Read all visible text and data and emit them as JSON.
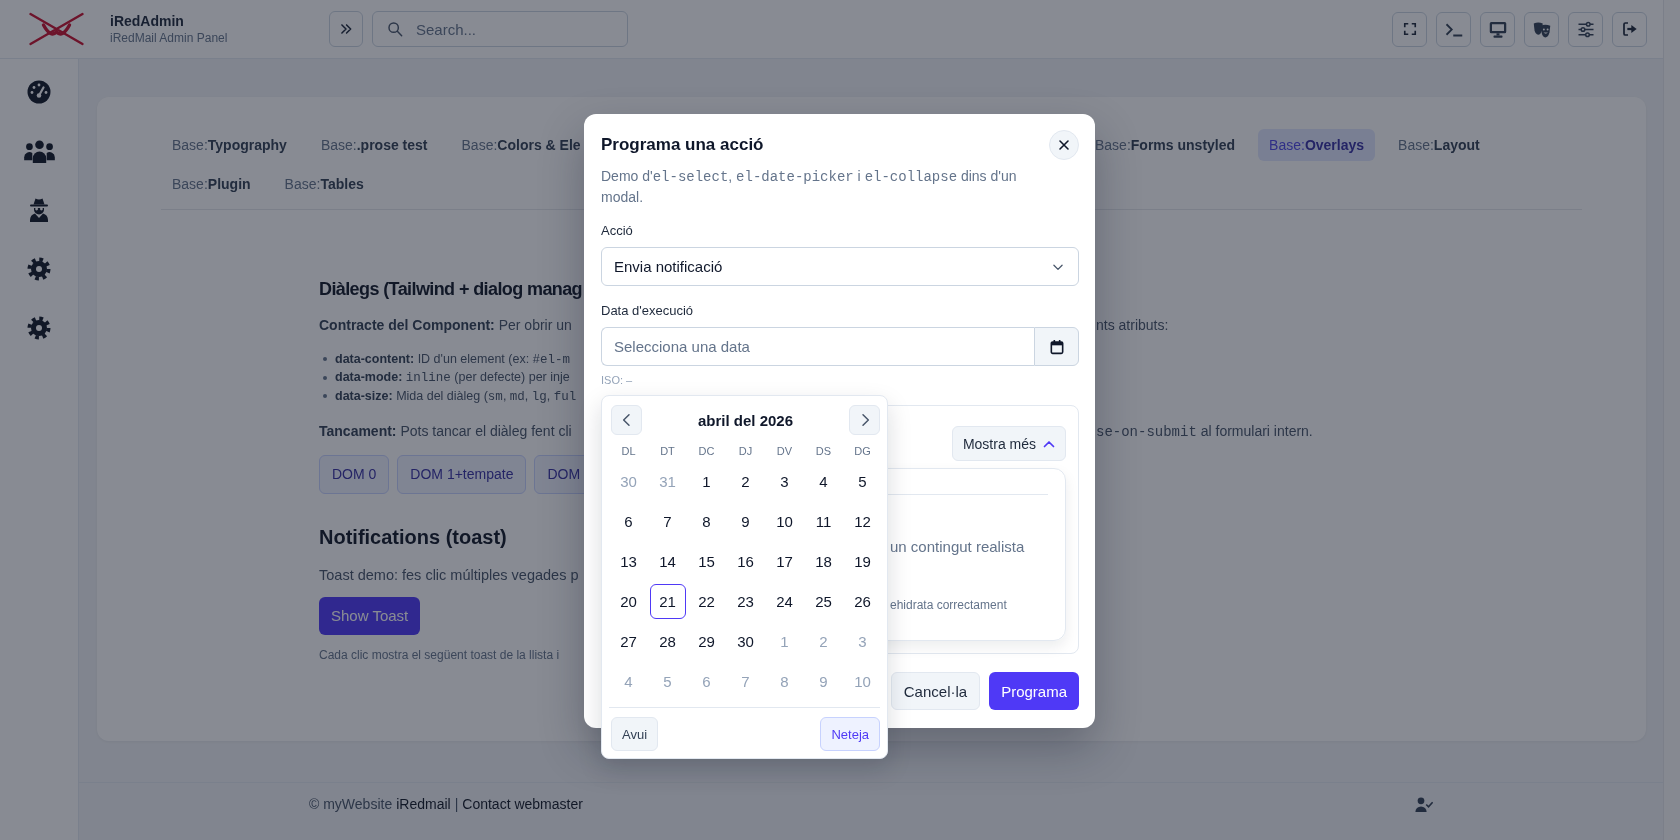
{
  "header": {
    "title": "iRedAdmin",
    "subtitle": "iRedMail Admin Panel",
    "search": {
      "placeholder": "Search..."
    }
  },
  "tab_rows": [
    {
      "items": [
        {
          "label": "Base:**Typography**",
          "selected": false
        },
        {
          "label": "Base:**.prose test**",
          "selected": false
        },
        {
          "label": "Base:**Colors & Ele**",
          "selected": false
        }
      ],
      "items_after_dialog": [
        {
          "label": "Base:**Forms unstyled**",
          "selected": false
        },
        {
          "label": "Base:**Overlays**",
          "selected": true
        },
        {
          "label": "Base:**Layout**",
          "selected": false
        }
      ]
    },
    {
      "items": [
        {
          "label": "Base:**Plugin**",
          "selected": false
        },
        {
          "label": "Base:**Tables**",
          "selected": false
        }
      ]
    }
  ],
  "dialogs_section": {
    "heading": "Diàlegs (Tailwind + dialog manag",
    "contract": {
      "before_dialog": [
        {
          "kind": "text",
          "text": "**Contracte del Component:** Per obrir un"
        }
      ],
      "after_dialog": [
        {
          "kind": "text",
          "text": "nts atributs:"
        }
      ]
    },
    "attributes": [
      [
        {
          "kind": "text",
          "text": "**data-content:** ID d'un element (ex: "
        },
        {
          "kind": "code",
          "text": "#el-m"
        }
      ],
      [
        {
          "kind": "text",
          "text": "**data-mode:** "
        },
        {
          "kind": "code",
          "text": "inline"
        },
        {
          "kind": "text",
          "text": " (per defecte) per inje"
        }
      ],
      [
        {
          "kind": "text",
          "text": "**data-size:** Mida del diàleg ("
        },
        {
          "kind": "code",
          "text": "sm"
        },
        {
          "kind": "text",
          "text": ", "
        },
        {
          "kind": "code",
          "text": "md"
        },
        {
          "kind": "text",
          "text": ", "
        },
        {
          "kind": "code",
          "text": "lg"
        },
        {
          "kind": "text",
          "text": ", "
        },
        {
          "kind": "code",
          "text": "ful"
        }
      ]
    ],
    "closing": {
      "before_dialog": [
        {
          "kind": "text",
          "text": "**Tancament:** Pots tancar el diàleg fent cli"
        }
      ],
      "after_dialog": [
        {
          "kind": "code",
          "text": "se-on-submit"
        },
        {
          "kind": "text",
          "text": " al formulari intern."
        }
      ]
    },
    "buttons": [
      "DOM 0",
      "DOM 1+tempate",
      "DOM"
    ]
  },
  "notifications": {
    "heading": "Notifications (toast)",
    "text": "Toast demo: fes clic múltiples vegades p",
    "button": "Show Toast",
    "note": "Cada clic mostra el següent toast de la llista i"
  },
  "footer": {
    "text": "© myWebsite",
    "link": "iRedmail",
    "separator": "|",
    "contact": "Contact webmaster"
  },
  "dialog": {
    "title": "Programa una acció",
    "description": [
      {
        "kind": "text",
        "text": "Demo d'"
      },
      {
        "kind": "code",
        "text": "el-select"
      },
      {
        "kind": "text",
        "text": ", "
      },
      {
        "kind": "code",
        "text": "el-date-picker"
      },
      {
        "kind": "text",
        "text": " i "
      },
      {
        "kind": "code",
        "text": "el-collapse"
      },
      {
        "kind": "text",
        "text": " dins d'un modal."
      }
    ],
    "action": {
      "label": "Acció",
      "value": "Envia notificació"
    },
    "date": {
      "label": "Data d'execució",
      "placeholder": "Selecciona una data",
      "iso": "ISO: –"
    },
    "calendar": {
      "month": "abril del 2026",
      "weekdays": [
        "DL",
        "DT",
        "DC",
        "DJ",
        "DV",
        "DS",
        "DG"
      ],
      "days": [
        {
          "d": "30",
          "outside": true,
          "today": false
        },
        {
          "d": "31",
          "outside": true,
          "today": false
        },
        {
          "d": "1",
          "outside": false,
          "today": false
        },
        {
          "d": "2",
          "outside": false,
          "today": false
        },
        {
          "d": "3",
          "outside": false,
          "today": false
        },
        {
          "d": "4",
          "outside": false,
          "today": false
        },
        {
          "d": "5",
          "outside": false,
          "today": false
        },
        {
          "d": "6",
          "outside": false,
          "today": false
        },
        {
          "d": "7",
          "outside": false,
          "today": false
        },
        {
          "d": "8",
          "outside": false,
          "today": false
        },
        {
          "d": "9",
          "outside": false,
          "today": false
        },
        {
          "d": "10",
          "outside": false,
          "today": false
        },
        {
          "d": "11",
          "outside": false,
          "today": false
        },
        {
          "d": "12",
          "outside": false,
          "today": false
        },
        {
          "d": "13",
          "outside": false,
          "today": false
        },
        {
          "d": "14",
          "outside": false,
          "today": false
        },
        {
          "d": "15",
          "outside": false,
          "today": false
        },
        {
          "d": "16",
          "outside": false,
          "today": false
        },
        {
          "d": "17",
          "outside": false,
          "today": false
        },
        {
          "d": "18",
          "outside": false,
          "today": false
        },
        {
          "d": "19",
          "outside": false,
          "today": false
        },
        {
          "d": "20",
          "outside": false,
          "today": false
        },
        {
          "d": "21",
          "outside": false,
          "today": true
        },
        {
          "d": "22",
          "outside": false,
          "today": false
        },
        {
          "d": "23",
          "outside": false,
          "today": false
        },
        {
          "d": "24",
          "outside": false,
          "today": false
        },
        {
          "d": "25",
          "outside": false,
          "today": false
        },
        {
          "d": "26",
          "outside": false,
          "today": false
        },
        {
          "d": "27",
          "outside": false,
          "today": false
        },
        {
          "d": "28",
          "outside": false,
          "today": false
        },
        {
          "d": "29",
          "outside": false,
          "today": false
        },
        {
          "d": "30",
          "outside": false,
          "today": false
        },
        {
          "d": "1",
          "outside": true,
          "today": false
        },
        {
          "d": "2",
          "outside": true,
          "today": false
        },
        {
          "d": "3",
          "outside": true,
          "today": false
        },
        {
          "d": "4",
          "outside": true,
          "today": false
        },
        {
          "d": "5",
          "outside": true,
          "today": false
        },
        {
          "d": "6",
          "outside": true,
          "today": false
        },
        {
          "d": "7",
          "outside": true,
          "today": false
        },
        {
          "d": "8",
          "outside": true,
          "today": false
        },
        {
          "d": "9",
          "outside": true,
          "today": false
        },
        {
          "d": "10",
          "outside": true,
          "today": false
        }
      ],
      "today_button": "Avui",
      "clear_button": "Neteja"
    },
    "details": {
      "toggle": "Mostra més",
      "expanded": true,
      "lines": [
        {
          "kind": "body",
          "text": "un contingut realista"
        },
        {
          "kind": "note",
          "text": "ehidrata correctament"
        }
      ]
    },
    "cancel": "Cancel·la",
    "submit": "Programa"
  }
}
